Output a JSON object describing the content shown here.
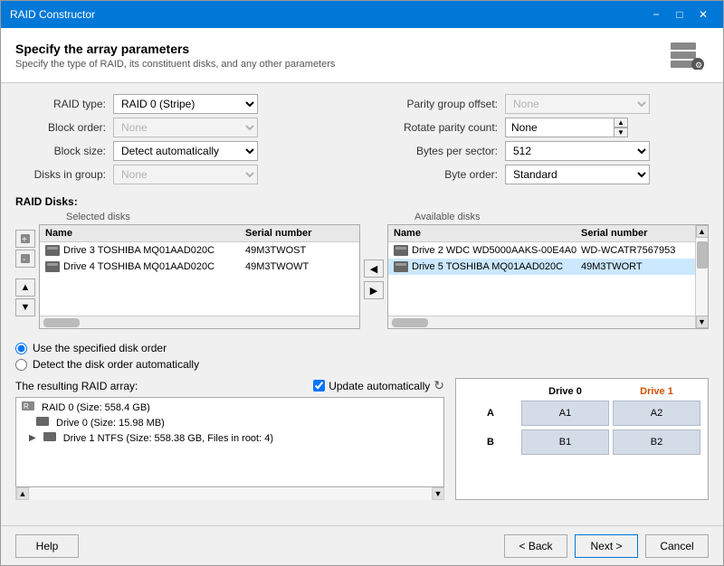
{
  "window": {
    "title": "RAID Constructor",
    "header": {
      "title": "Specify the array parameters",
      "subtitle": "Specify the type of RAID, its constituent disks, and any other parameters"
    }
  },
  "titlebar": {
    "minimize": "−",
    "maximize": "□",
    "close": "✕"
  },
  "left_params": {
    "raid_type_label": "RAID type:",
    "raid_type_value": "RAID 0 (Stripe)",
    "block_order_label": "Block order:",
    "block_order_value": "None",
    "block_size_label": "Block size:",
    "block_size_value": "Detect automatically",
    "disks_in_group_label": "Disks in group:",
    "disks_in_group_value": "None"
  },
  "right_params": {
    "parity_offset_label": "Parity group offset:",
    "parity_offset_value": "None",
    "rotate_parity_label": "Rotate parity count:",
    "rotate_parity_value": "None",
    "bytes_per_sector_label": "Bytes per sector:",
    "bytes_per_sector_value": "512",
    "byte_order_label": "Byte order:",
    "byte_order_value": "Standard"
  },
  "disks_section": {
    "label": "RAID Disks:",
    "selected_label": "Selected disks",
    "available_label": "Available disks",
    "col_name": "Name",
    "col_serial": "Serial number",
    "selected_disks": [
      {
        "name": "Drive 3 TOSHIBA MQ01AAD020C",
        "serial": "49M3TWOST"
      },
      {
        "name": "Drive 4 TOSHIBA MQ01AAD020C",
        "serial": "49M3TWOWT"
      }
    ],
    "available_disks": [
      {
        "name": "Drive 2 WDC WD5000AAKS-00E4A0",
        "serial": "WD-WCATR7567953",
        "selected": false
      },
      {
        "name": "Drive 5 TOSHIBA MQ01AAD020C",
        "serial": "49M3TWORT",
        "selected": true
      }
    ]
  },
  "disk_order": {
    "option1": "Use the specified disk order",
    "option2": "Detect the disk order automatically"
  },
  "result": {
    "label": "The resulting RAID array:",
    "update_label": "Update automatically",
    "tree": [
      {
        "indent": 0,
        "text": "RAID 0 (Size: 558.4 GB)",
        "has_arrow": false
      },
      {
        "indent": 1,
        "text": "Drive 0 (Size: 15.98 MB)",
        "has_arrow": false
      },
      {
        "indent": 1,
        "text": "Drive 1 NTFS (Size: 558.38 GB, Files in root: 4)",
        "has_arrow": true
      }
    ]
  },
  "drive_grid": {
    "headers": [
      "",
      "Drive 0",
      "Drive 1"
    ],
    "rows": [
      {
        "label": "A",
        "cells": [
          "A1",
          "A2"
        ]
      },
      {
        "label": "B",
        "cells": [
          "B1",
          "B2"
        ]
      }
    ]
  },
  "footer": {
    "help": "Help",
    "back": "< Back",
    "next": "Next >",
    "cancel": "Cancel"
  }
}
